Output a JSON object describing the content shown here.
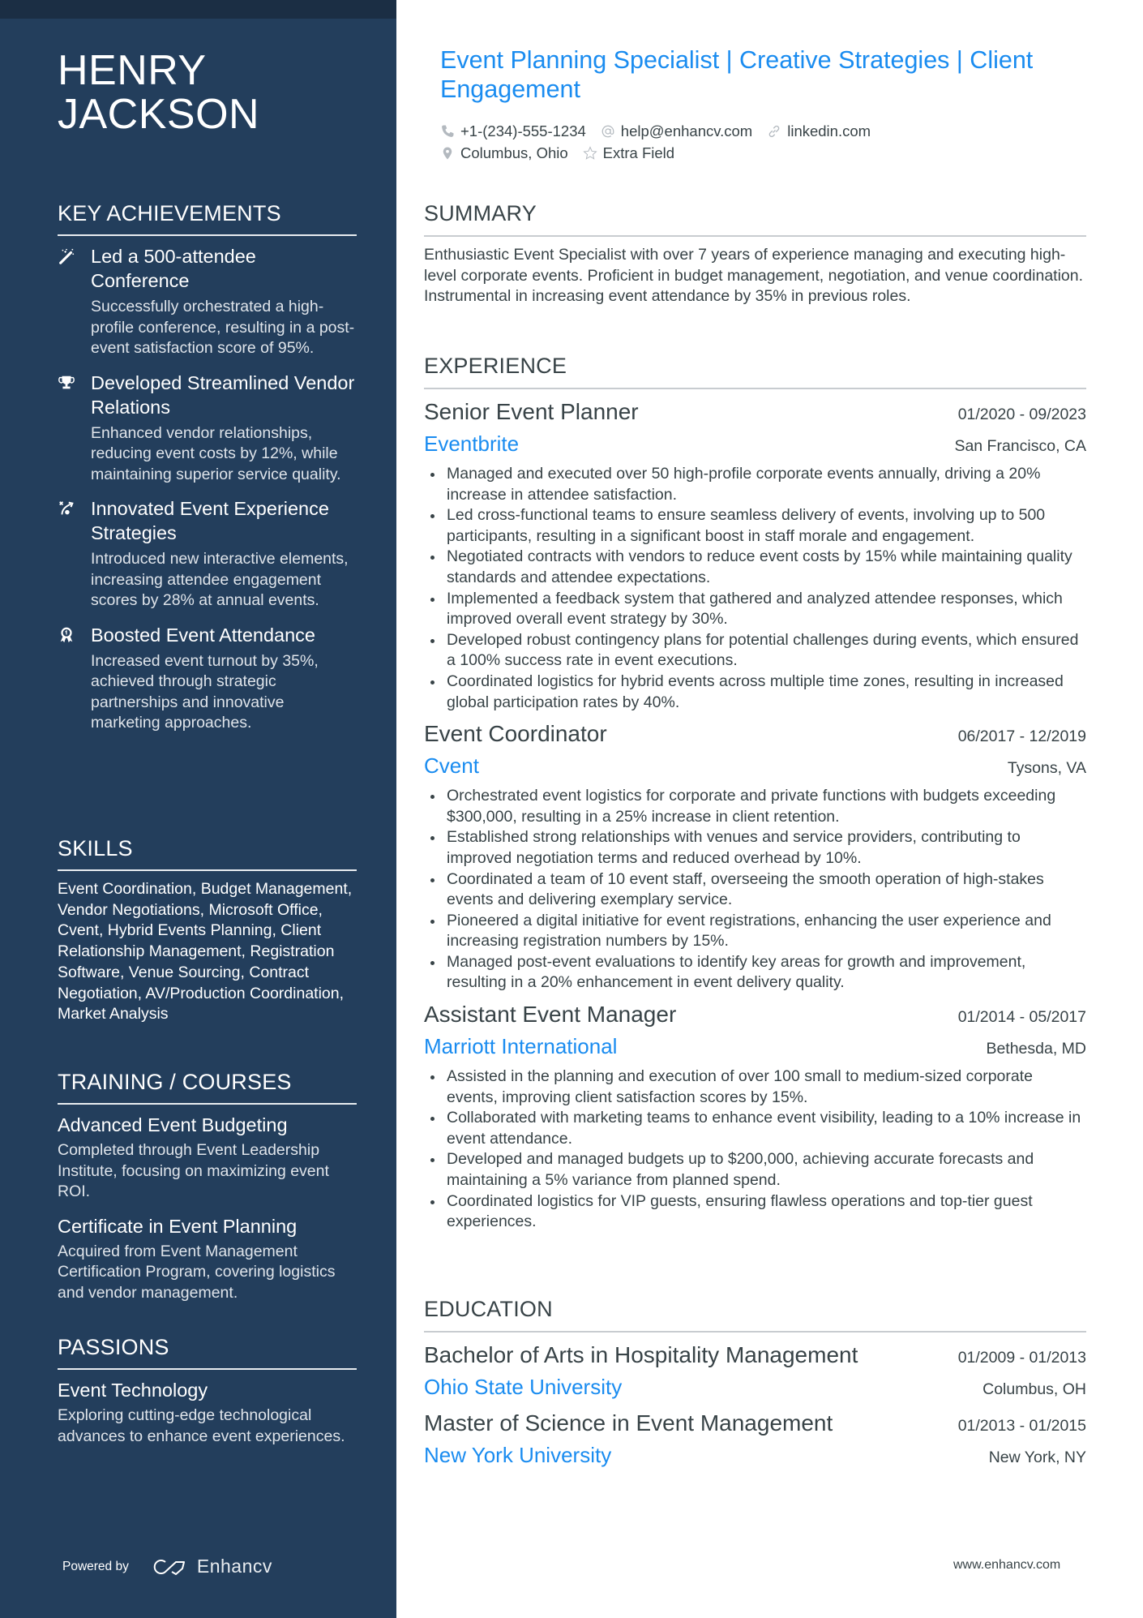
{
  "sidebar": {
    "name": "HENRY JACKSON",
    "achievements_title": "KEY ACHIEVEMENTS",
    "achievements": [
      {
        "icon": "magic-wand-icon",
        "title": "Led a 500-attendee Conference",
        "desc": "Successfully orchestrated a high-profile conference, resulting in a post-event satisfaction score of 95%."
      },
      {
        "icon": "trophy-icon",
        "title": "Developed Streamlined Vendor Relations",
        "desc": "Enhanced vendor relationships, reducing event costs by 12%, while maintaining superior service quality."
      },
      {
        "icon": "strategy-icon",
        "title": "Innovated Event Experience Strategies",
        "desc": "Introduced new interactive elements, increasing attendee engagement scores by 28% at annual events."
      },
      {
        "icon": "medal-icon",
        "title": "Boosted Event Attendance",
        "desc": "Increased event turnout by 35%, achieved through strategic partnerships and innovative marketing approaches."
      }
    ],
    "skills_title": "SKILLS",
    "skills_text": "Event Coordination, Budget Management, Vendor Negotiations, Microsoft Office, Cvent, Hybrid Events Planning, Client Relationship Management, Registration Software, Venue Sourcing, Contract Negotiation, AV/Production Coordination, Market Analysis",
    "training_title": "TRAINING / COURSES",
    "courses": [
      {
        "title": "Advanced Event Budgeting",
        "desc": "Completed through Event Leadership Institute, focusing on maximizing event ROI."
      },
      {
        "title": "Certificate in Event Planning",
        "desc": "Acquired from Event Management Certification Program, covering logistics and vendor management."
      }
    ],
    "passions_title": "PASSIONS",
    "passions": [
      {
        "title": "Event Technology",
        "desc": "Exploring cutting-edge technological advances to enhance event experiences."
      }
    ],
    "powered_by": "Powered by",
    "brand": "Enhancv"
  },
  "header": {
    "headline": "Event Planning Specialist | Creative Strategies | Client Engagement",
    "phone": "+1-(234)-555-1234",
    "email": "help@enhancv.com",
    "link": "linkedin.com",
    "location": "Columbus, Ohio",
    "extra": "Extra Field"
  },
  "summary": {
    "title": "SUMMARY",
    "text": "Enthusiastic Event Specialist with over 7 years of experience managing and executing high-level corporate events. Proficient in budget management, negotiation, and venue coordination. Instrumental in increasing event attendance by 35% in previous roles."
  },
  "experience": {
    "title": "EXPERIENCE",
    "jobs": [
      {
        "title": "Senior Event Planner",
        "dates": "01/2020 - 09/2023",
        "company": "Eventbrite",
        "location": "San Francisco, CA",
        "bullets": [
          "Managed and executed over 50 high-profile corporate events annually, driving a 20% increase in attendee satisfaction.",
          "Led cross-functional teams to ensure seamless delivery of events, involving up to 500 participants, resulting in a significant boost in staff morale and engagement.",
          "Negotiated contracts with vendors to reduce event costs by 15% while maintaining quality standards and attendee expectations.",
          "Implemented a feedback system that gathered and analyzed attendee responses, which improved overall event strategy by 30%.",
          "Developed robust contingency plans for potential challenges during events, which ensured a 100% success rate in event executions.",
          "Coordinated logistics for hybrid events across multiple time zones, resulting in increased global participation rates by 40%."
        ]
      },
      {
        "title": "Event Coordinator",
        "dates": "06/2017 - 12/2019",
        "company": "Cvent",
        "location": "Tysons, VA",
        "bullets": [
          "Orchestrated event logistics for corporate and private functions with budgets exceeding $300,000, resulting in a 25% increase in client retention.",
          "Established strong relationships with venues and service providers, contributing to improved negotiation terms and reduced overhead by 10%.",
          "Coordinated a team of 10 event staff, overseeing the smooth operation of high-stakes events and delivering exemplary service.",
          "Pioneered a digital initiative for event registrations, enhancing the user experience and increasing registration numbers by 15%.",
          "Managed post-event evaluations to identify key areas for growth and improvement, resulting in a 20% enhancement in event delivery quality."
        ]
      },
      {
        "title": "Assistant Event Manager",
        "dates": "01/2014 - 05/2017",
        "company": "Marriott International",
        "location": "Bethesda, MD",
        "bullets": [
          "Assisted in the planning and execution of over 100 small to medium-sized corporate events, improving client satisfaction scores by 15%.",
          "Collaborated with marketing teams to enhance event visibility, leading to a 10% increase in event attendance.",
          "Developed and managed budgets up to $200,000, achieving accurate forecasts and maintaining a 5% variance from planned spend.",
          "Coordinated logistics for VIP guests, ensuring flawless operations and top-tier guest experiences."
        ]
      }
    ]
  },
  "education": {
    "title": "EDUCATION",
    "items": [
      {
        "degree": "Bachelor of Arts in Hospitality Management",
        "dates": "01/2009 - 01/2013",
        "school": "Ohio State University",
        "location": "Columbus, OH"
      },
      {
        "degree": "Master of Science in Event Management",
        "dates": "01/2013 - 01/2015",
        "school": "New York University",
        "location": "New York, NY"
      }
    ]
  },
  "footer": {
    "url": "www.enhancv.com"
  },
  "colors": {
    "sidebar": "#233e5c",
    "accent": "#1a8cf0",
    "text": "#384347"
  }
}
